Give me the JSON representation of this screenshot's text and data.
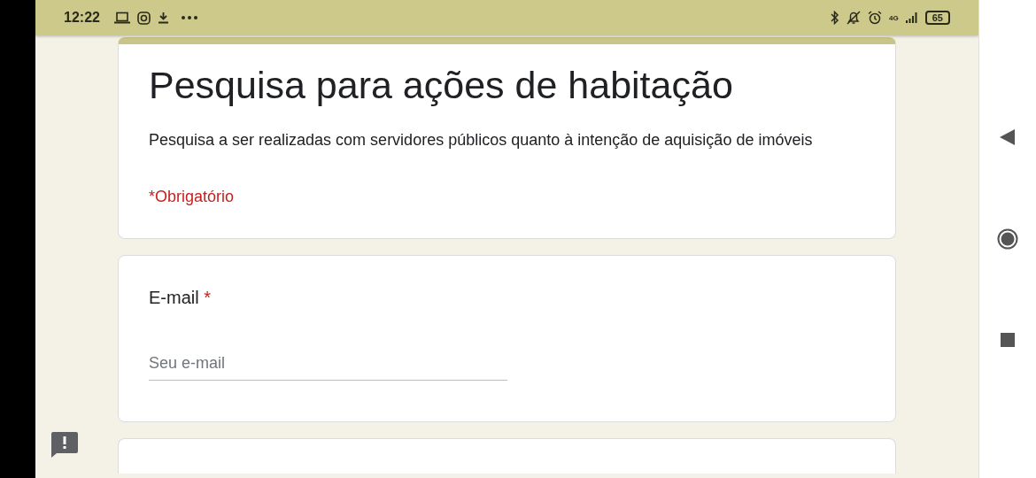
{
  "status_bar": {
    "time": "12:22",
    "network": "4G",
    "battery": "65"
  },
  "form": {
    "title": "Pesquisa para ações de habitação",
    "description": "Pesquisa a ser realizadas com servidores públicos quanto à intenção de aquisição de imóveis",
    "required_note": "*Obrigatório"
  },
  "questions": [
    {
      "label": "E-mail",
      "required": true,
      "required_mark": "*",
      "placeholder": "Seu e-mail"
    }
  ]
}
